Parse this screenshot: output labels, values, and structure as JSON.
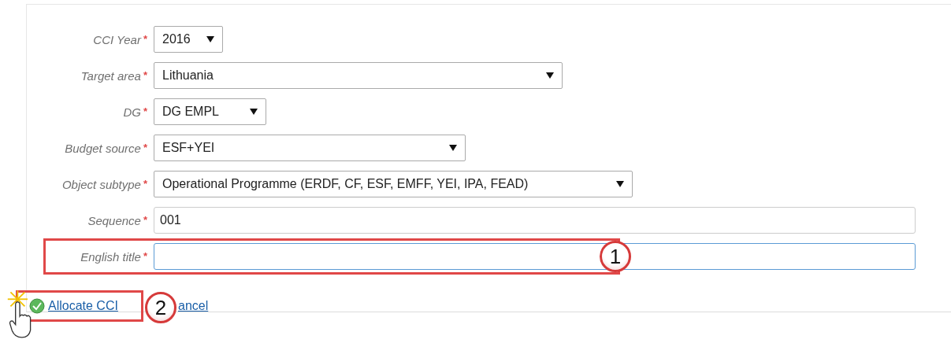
{
  "form": {
    "fields": [
      {
        "label": "CCI Year",
        "marker": "*",
        "kind": "select",
        "value": "2016",
        "focused": false,
        "highlighted": false
      },
      {
        "label": "Target area",
        "marker": "*",
        "kind": "select",
        "value": "Lithuania",
        "focused": false,
        "highlighted": false
      },
      {
        "label": "DG",
        "marker": "*",
        "kind": "select",
        "value": "DG EMPL",
        "focused": false,
        "highlighted": false
      },
      {
        "label": "Budget source",
        "marker": "*",
        "kind": "select",
        "value": "ESF+YEI",
        "focused": false,
        "highlighted": false
      },
      {
        "label": "Object subtype",
        "marker": "*",
        "kind": "select",
        "value": "Operational Programme (ERDF, CF, ESF, EMFF, YEI, IPA, FEAD)",
        "focused": false,
        "highlighted": false
      },
      {
        "label": "Sequence",
        "marker": "*",
        "kind": "text",
        "value": "001",
        "focused": false,
        "highlighted": false
      },
      {
        "label": "English title",
        "marker": "*",
        "kind": "text",
        "focused": true,
        "highlighted": true
      }
    ],
    "actions": [
      {
        "label": "Allocate CCI",
        "kind": "allocate",
        "highlighted": true
      },
      {
        "label": "ancel",
        "kind": "cancel",
        "highlighted": false
      }
    ]
  },
  "callouts": [
    {
      "number": "1"
    },
    {
      "number": "2"
    }
  ]
}
